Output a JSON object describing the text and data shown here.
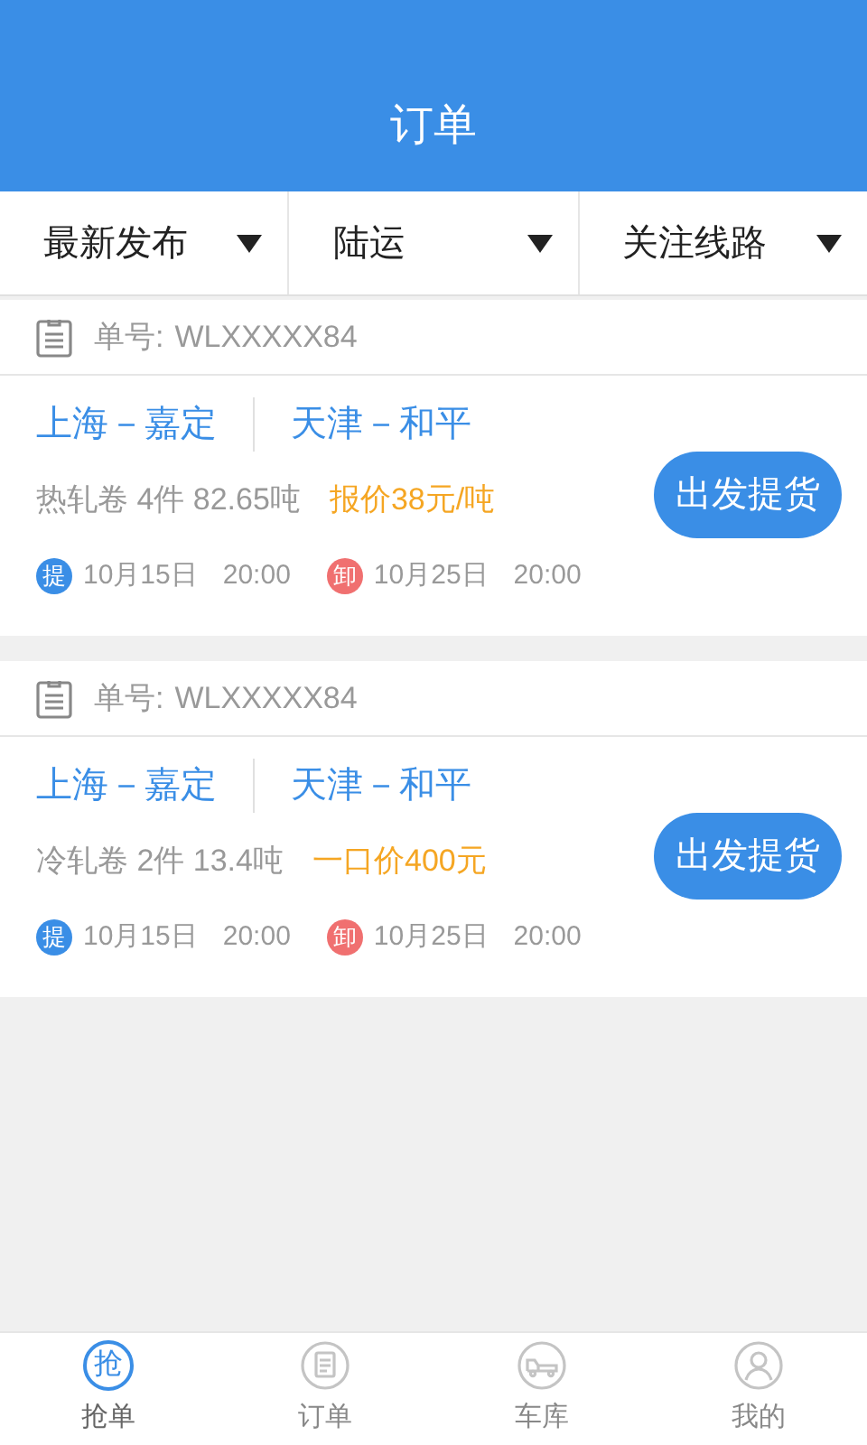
{
  "header": {
    "title": "订单"
  },
  "filters": [
    {
      "label": "最新发布"
    },
    {
      "label": "陆运"
    },
    {
      "label": "关注线路"
    }
  ],
  "orders": [
    {
      "number_label": "单号:",
      "number": "WLXXXXX84",
      "origin": "上海－嘉定",
      "destination": "天津－和平",
      "cargo": "热轧卷 4件 82.65吨",
      "price": "报价38元/吨",
      "action": "出发提货",
      "pickup": {
        "badge": "提",
        "color": "#3a8ee6",
        "date": "10月15日",
        "time": "20:00"
      },
      "unload": {
        "badge": "卸",
        "color": "#f07070",
        "date": "10月25日",
        "time": "20:00"
      }
    },
    {
      "number_label": "单号:",
      "number": "WLXXXXX84",
      "origin": "上海－嘉定",
      "destination": "天津－和平",
      "cargo": "冷轧卷 2件 13.4吨",
      "price": "一口价400元",
      "action": "出发提货",
      "pickup": {
        "badge": "提",
        "color": "#3a8ee6",
        "date": "10月15日",
        "time": "20:00"
      },
      "unload": {
        "badge": "卸",
        "color": "#f07070",
        "date": "10月25日",
        "time": "20:00"
      }
    }
  ],
  "tabbar": [
    {
      "kind": "text",
      "icon_text": "抢",
      "label": "抢单",
      "selected": true
    },
    {
      "kind": "document",
      "label": "订单",
      "selected": false
    },
    {
      "kind": "truck",
      "label": "车库",
      "selected": false
    },
    {
      "kind": "person",
      "label": "我的",
      "selected": false
    }
  ]
}
